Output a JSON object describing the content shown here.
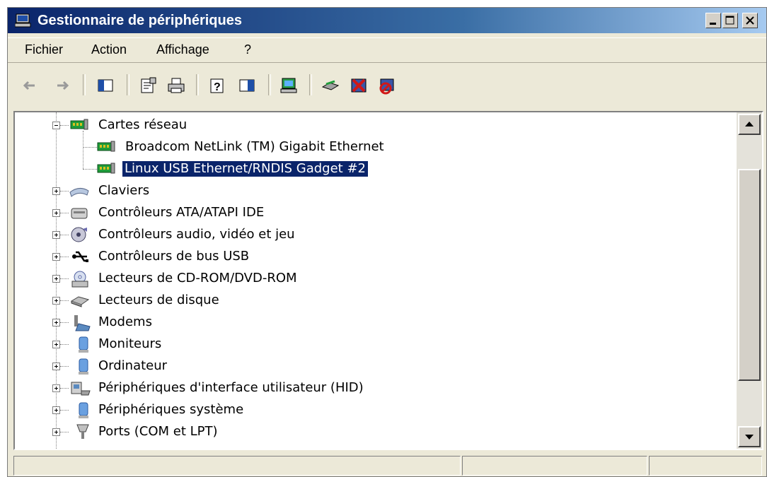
{
  "window": {
    "title": "Gestionnaire de périphériques"
  },
  "menu": {
    "items": [
      "Fichier",
      "Action",
      "Affichage",
      "?"
    ]
  },
  "toolbar": {
    "buttons": [
      "back-icon",
      "forward-icon",
      "console-tree-icon",
      "properties-icon",
      "print-icon",
      "help-icon",
      "show-hide-icon",
      "scan-hardware-icon",
      "update-driver-icon",
      "uninstall-icon",
      "disable-icon"
    ]
  },
  "tree": {
    "expanded_category": "Cartes réseau",
    "children": [
      "Broadcom NetLink (TM) Gigabit Ethernet",
      "Linux USB Ethernet/RNDIS Gadget #2"
    ],
    "selected": "Linux USB Ethernet/RNDIS Gadget #2",
    "categories": [
      "Claviers",
      "Contrôleurs ATA/ATAPI IDE",
      "Contrôleurs audio, vidéo et jeu",
      "Contrôleurs de bus USB",
      "Lecteurs de CD-ROM/DVD-ROM",
      "Lecteurs de disque",
      "Modems",
      "Moniteurs",
      "Ordinateur",
      "Périphériques d'interface utilisateur (HID)",
      "Périphériques système",
      "Ports (COM et LPT)"
    ]
  },
  "colors": {
    "selection": "#0a246a",
    "titlebar_start": "#0a246a",
    "titlebar_end": "#a6caf0",
    "chrome": "#ece9d8"
  }
}
